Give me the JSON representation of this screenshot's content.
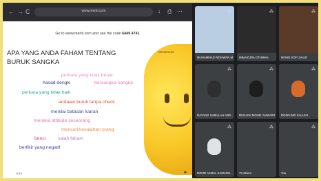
{
  "browser": {
    "url": "www.menti.com",
    "nav": {
      "back": "←",
      "forward": "→",
      "reload": "C"
    },
    "toolbar": {
      "share": "⎙",
      "menu": "⋯"
    }
  },
  "slide": {
    "instruction_prefix": "Go to www.menti.com and use the code",
    "code": "6449 4741",
    "question_line1": "APA YANG ANDA FAHAM TENTANG",
    "question_line2": "BURUK SANGKA",
    "words": [
      {
        "text": "perkara yang tidak benar",
        "color": "#f28cc0"
      },
      {
        "text": "hasad dengki",
        "color": "#2f3a8f"
      },
      {
        "text": "bersangka-sangka",
        "color": "#f27ab0"
      },
      {
        "text": "perkara yang tidak baik",
        "color": "#2aa39b"
      },
      {
        "text": "andaian buruk tanpa check",
        "color": "#e44a2f"
      },
      {
        "text": "menilai batasan luaran",
        "color": "#3d4aa8"
      },
      {
        "text": "meneka attitude seseorang",
        "color": "#ef6fa8"
      },
      {
        "text": "mencari kesalahan orang",
        "color": "#f08a45"
      },
      {
        "text": "benci",
        "color": "#e23a52"
      },
      {
        "text": "salah faham",
        "color": "#b37cd6"
      },
      {
        "text": "berfikir yang negatif",
        "color": "#3346a5"
      }
    ],
    "brand": "Mentimeter"
  },
  "participants": [
    {
      "name": "MUHAMMAD RIDHWAN MHD...",
      "color": "#b9cde3"
    },
    {
      "name": "IMMAZURA OTHMAN",
      "color": "#2b2b2b"
    },
    {
      "name": "MOHD SOFI DAUD",
      "color": "#5a3b2a"
    },
    {
      "name": "DAYANG SABILLAH ABD...",
      "color": "#2f2f2f"
    },
    {
      "name": "RUDAINI MOHD. NAWAWI",
      "color": "#1d1d1d"
    },
    {
      "name": "ROSNI MD SALLEH",
      "color": "#d86a2b"
    },
    {
      "name": "MOHD AKMAL KAMARU...",
      "color": "#dfe3e6"
    },
    {
      "name": "73 others",
      "color": "#3c4043"
    },
    {
      "name": "You",
      "color": "#3c4043"
    }
  ],
  "colors": {
    "accent": "#f3df79"
  }
}
